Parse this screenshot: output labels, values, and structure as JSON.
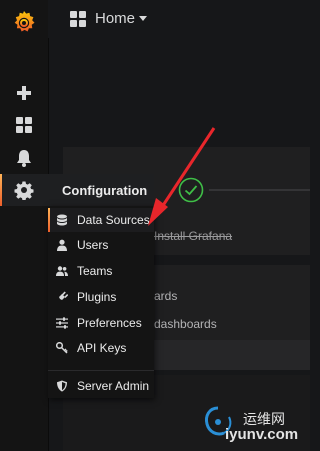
{
  "navbar": {
    "title": "Home"
  },
  "sidemenu": {
    "items": [
      "grafana-logo",
      "plus-icon",
      "dashboards-icon",
      "bell-icon",
      "gear-icon"
    ]
  },
  "dashboard_bg": {
    "install_text": "Install Grafana",
    "row2_text": "ards",
    "row3_text": "dashboards"
  },
  "config_menu": {
    "header": "Configuration",
    "items": [
      {
        "label": "Data Sources",
        "icon": "database-icon",
        "active": true
      },
      {
        "label": "Users",
        "icon": "user-icon"
      },
      {
        "label": "Teams",
        "icon": "users-icon"
      },
      {
        "label": "Plugins",
        "icon": "plug-icon"
      },
      {
        "label": "Preferences",
        "icon": "sliders-icon"
      },
      {
        "label": "API Keys",
        "icon": "key-icon"
      }
    ],
    "footer_item": {
      "label": "Server Admin",
      "icon": "shield-icon"
    }
  },
  "colors": {
    "accent_orange": "#f05a28",
    "success_green": "#3fbf47",
    "annotation_red": "#e8262b"
  },
  "watermark": {
    "cn": "运维网",
    "url": "iyunv.com"
  }
}
